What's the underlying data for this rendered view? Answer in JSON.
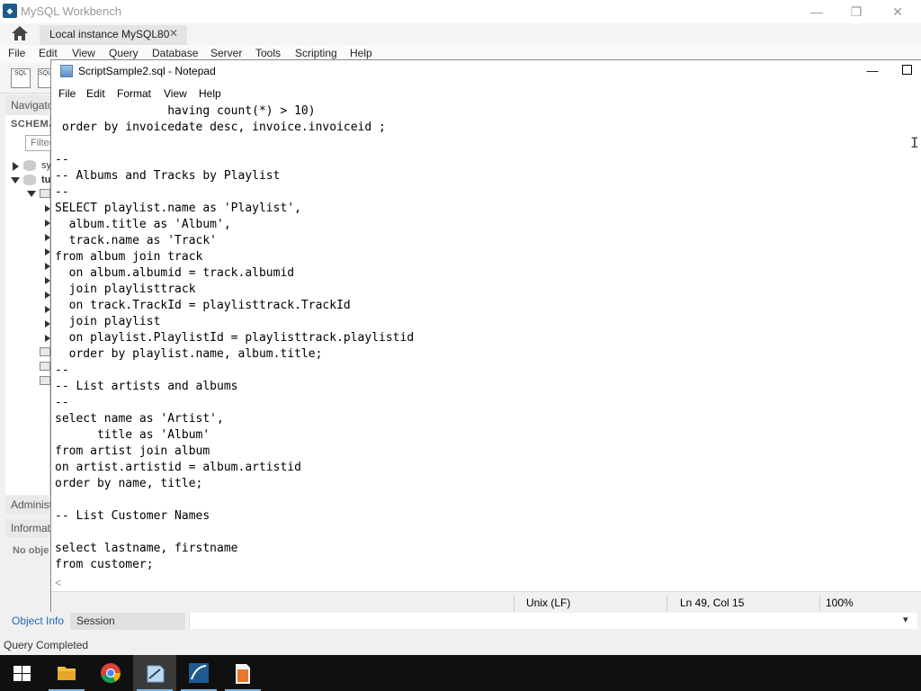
{
  "workbench": {
    "title": "MySQL Workbench",
    "connection_tab": "Local instance MySQL80",
    "menu": [
      "File",
      "Edit",
      "View",
      "Query",
      "Database",
      "Server",
      "Tools",
      "Scripting",
      "Help"
    ],
    "toolbar_tools": [
      "SQL",
      "SQL"
    ],
    "navigator_label": "Navigato",
    "schemas_label": "SCHEMA",
    "filter_placeholder": "Filter",
    "tree": {
      "sys": "sy",
      "tunes": "tu"
    },
    "administration_label": "Administ",
    "information_label": "Informat",
    "no_object": "No obje",
    "bottom_tabs": [
      "Object Info",
      "Session"
    ],
    "status": "Query Completed"
  },
  "notepad": {
    "title": "ScriptSample2.sql - Notepad",
    "menu": [
      "File",
      "Edit",
      "Format",
      "View",
      "Help"
    ],
    "lines": [
      "                having count(*) > 10)",
      " order by invoicedate desc, invoice.invoiceid ;",
      "",
      "--",
      "-- Albums and Tracks by Playlist",
      "--",
      "SELECT playlist.name as 'Playlist',",
      "  album.title as 'Album',",
      "  track.name as 'Track'",
      "from album join track",
      "  on album.albumid = track.albumid",
      "  join playlisttrack",
      "  on track.TrackId = playlisttrack.TrackId",
      "  join playlist",
      "  on playlist.PlaylistId = playlisttrack.playlistid",
      "  order by playlist.name, album.title;",
      "--",
      "-- List artists and albums",
      "--",
      "select name as 'Artist',",
      "      title as 'Album'",
      "from artist join album",
      "on artist.artistid = album.artistid",
      "order by name, title;",
      "",
      "-- List Customer Names",
      "",
      "select lastname, firstname",
      "from customer;"
    ],
    "status": {
      "line_ending": "Unix (LF)",
      "position": "Ln 49, Col 15",
      "zoom": "100%"
    }
  },
  "taskbar": {
    "apps": [
      "start-icon",
      "file-explorer-icon",
      "chrome-icon",
      "notepad-icon",
      "mysql-workbench-icon",
      "powerpoint-icon"
    ]
  }
}
